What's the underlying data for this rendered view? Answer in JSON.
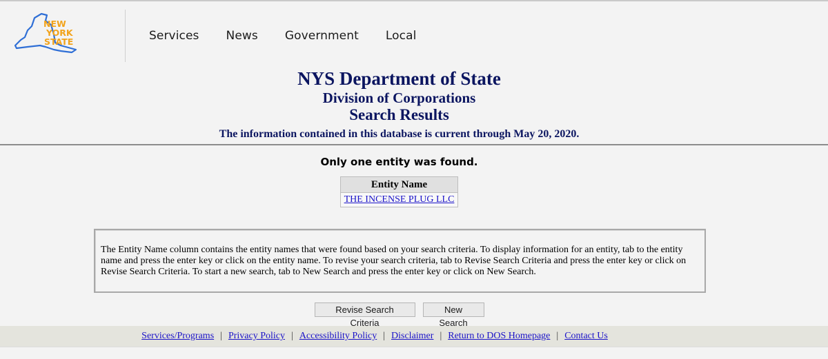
{
  "logo": {
    "line1": "NEW",
    "line2": "YORK",
    "line3": "STATE"
  },
  "nav": [
    {
      "label": "Services"
    },
    {
      "label": "News"
    },
    {
      "label": "Government"
    },
    {
      "label": "Local"
    }
  ],
  "title": {
    "main": "NYS Department of State",
    "sub": "Division of Corporations",
    "results": "Search Results",
    "current": "The information contained in this database is current through May 20, 2020."
  },
  "found_text": "Only one entity was found.",
  "results_table": {
    "header": "Entity Name",
    "rows": [
      {
        "name": "THE INCENSE PLUG LLC"
      }
    ]
  },
  "info_text": "The Entity Name column contains the entity names that were found based on your search criteria. To display information for an entity, tab to the entity name and press the enter key or click on the entity name. To revise your search criteria, tab to Revise Search Criteria and press the enter key or click on Revise Search Criteria. To start a new search, tab to New Search and press the enter key or click on New Search.",
  "buttons": {
    "revise": "Revise Search Criteria",
    "new_search": "New Search"
  },
  "footer_links": [
    {
      "label": "Services/Programs"
    },
    {
      "label": "Privacy Policy"
    },
    {
      "label": "Accessibility Policy"
    },
    {
      "label": "Disclaimer"
    },
    {
      "label": "Return to DOS Homepage"
    },
    {
      "label": "Contact Us"
    }
  ],
  "footer_separator": "|",
  "colors": {
    "brand_navy": "#0b1560",
    "state_blue": "#2f6fd6",
    "state_orange": "#f2a31b",
    "link": "#1a12c8"
  }
}
